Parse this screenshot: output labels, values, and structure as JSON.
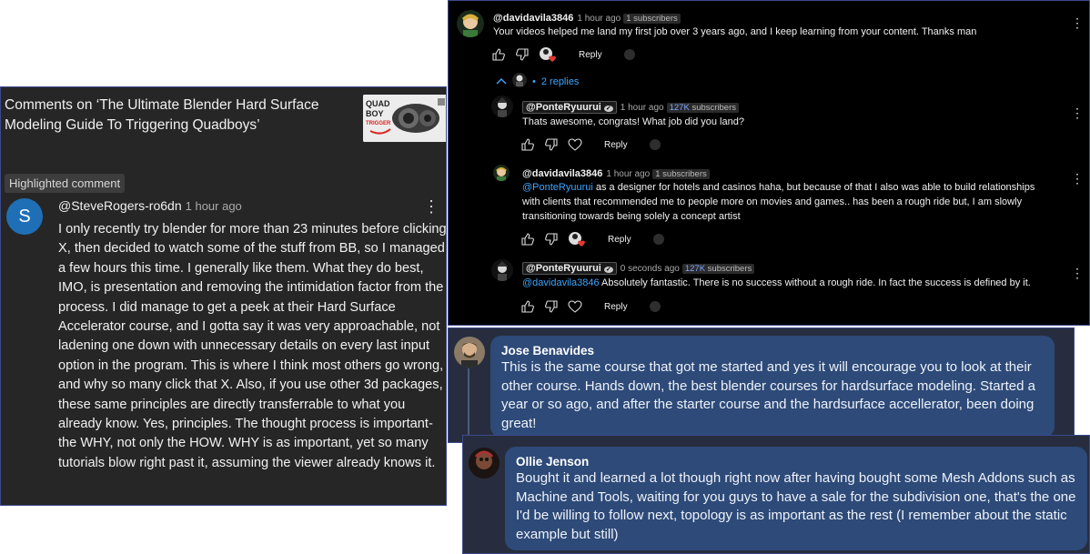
{
  "left": {
    "title": "Comments on ‘The Ultimate Blender Hard Surface Modeling Guide To Triggering Quadboys’",
    "thumbnail_text_1": "QUAD",
    "thumbnail_text_2": "BOY",
    "thumbnail_text_3": "TRIGGER",
    "badge": "Highlighted comment",
    "avatar_letter": "S",
    "author": "@SteveRogers-ro6dn",
    "time": "1 hour ago",
    "kebab": "⋮",
    "body": "I only recently try blender for more than 23 minutes before clicking X, then decided to watch some of the stuff from BB, so I managed a few hours this time. I generally like them. What they do best, IMO, is presentation and removing the intimidation factor from the process. I did manage to get a peek at their Hard Surface Accelerator course, and I gotta say it was very approachable, not ladening one down with unnecessary details on every last input option in the program. This is where I think most others go wrong, and why so many click that X. Also, if you use other 3d packages, these same principles are directly transferrable to what you already know. Yes, principles. The thought process is important- the WHY, not only the HOW. WHY is as important, yet so many tutorials blow right past it, assuming the viewer already knows it."
  },
  "yt": {
    "c1": {
      "author": "@davidavila3846",
      "time": "1 hour ago",
      "subs": "1 subscribers",
      "text": "Your videos helped me land my first job over 3 years ago, and I keep learning from your content. Thanks man",
      "reply": "Reply",
      "replies": "2 replies"
    },
    "r1": {
      "author": "@PonteRyuurui",
      "verified": "✓",
      "time": "1 hour ago",
      "subs_count": "127K",
      "subs_label": "subscribers",
      "text": "Thats awesome, congrats! What job did you land?",
      "reply": "Reply"
    },
    "r2": {
      "author": "@davidavila3846",
      "time": "1 hour ago",
      "subs": "1 subscribers",
      "mention": "@PonteRyuurui",
      "text_l1": " as a designer for hotels and casinos haha, but because of that I also was able to build relationships",
      "text_l2": "with clients that recommended me to people more on movies and games.. has been a rough ride but, I am slowly",
      "text_l3": "transitioning towards being solely a concept artist",
      "reply": "Reply"
    },
    "r3": {
      "author": "@PonteRyuurui",
      "verified": "✓",
      "time": "0 seconds ago",
      "subs_count": "127K",
      "subs_label": "subscribers",
      "mention": "@davidavila3846",
      "text": " Absolutely fantastic. There is no success without a rough ride. In fact the success is defined by it.",
      "reply": "Reply"
    },
    "kebab": "⋮"
  },
  "dc": {
    "c1": {
      "name": "Jose Benavides",
      "text": "This is the same course that got me started and yes it will encourage you to look at their other course. Hands down, the best blender courses for hardsurface modeling. Started a year or so ago, and after the starter course and the hardsurface accellerator, been doing great!"
    },
    "c2": {
      "name": "Ollie Jenson",
      "text": "Bought it and learned a lot though right now after having bought some Mesh Addons such as Machine and Tools, waiting for you guys to have a sale for the subdivision one, that's the one I'd be willing to follow next, topology is as important as the rest (I remember about the static example but still)"
    }
  },
  "colors": {
    "youtube_bg": "#000000",
    "left_bg": "#262626",
    "discord_bg": "#272d3e",
    "bubble": "#2d4a78",
    "mention": "#3ea6ff",
    "avatar_s": "#1f6fb6"
  }
}
